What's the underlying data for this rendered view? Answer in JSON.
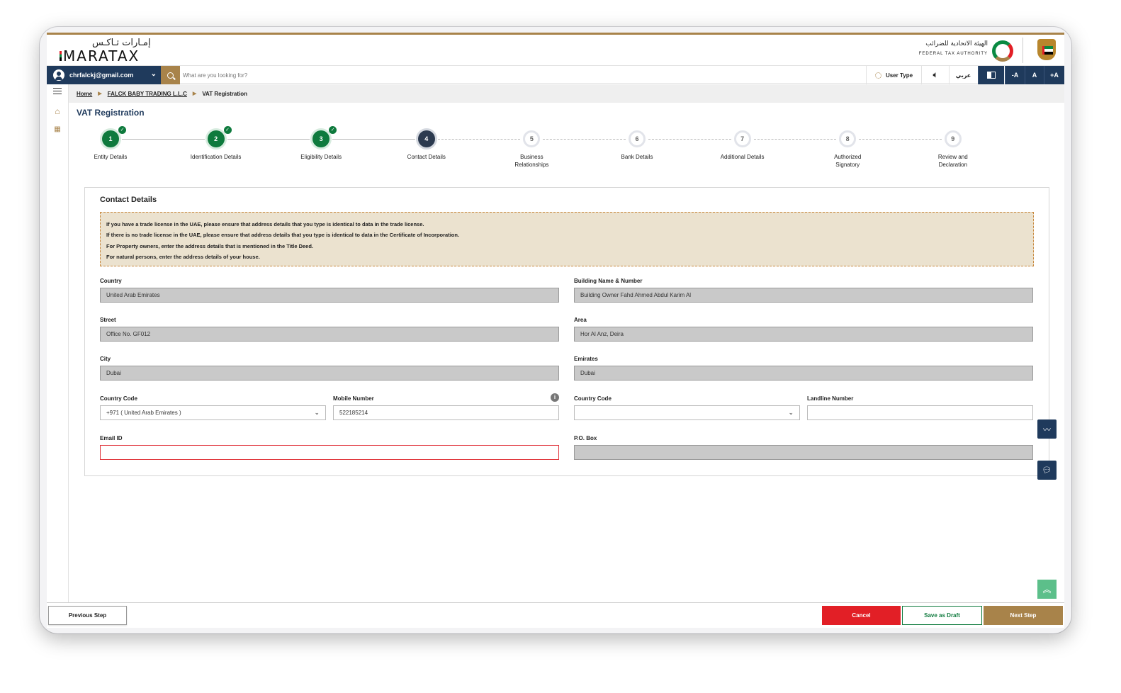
{
  "header": {
    "logo_arabic": "إمـارات تـاكـس",
    "logo_english": "MARATAX",
    "authority_arabic": "الهيئة الاتحادية للضرائب",
    "authority_english": "FEDERAL TAX AUTHORITY"
  },
  "toolbar": {
    "user_email": "chrfalckj@gmail.com",
    "search_placeholder": "What are you looking for?",
    "user_type_label": "User Type",
    "arabic_label": "عربي",
    "font_decrease": "-A",
    "font_reset": "A",
    "font_increase": "+A"
  },
  "breadcrumb": [
    "Home",
    "FALCK BABY TRADING L.L.C",
    "VAT Registration"
  ],
  "page": {
    "title": "VAT Registration"
  },
  "steps": [
    {
      "num": "1",
      "label": "Entity Details",
      "status": "done"
    },
    {
      "num": "2",
      "label": "Identification Details",
      "status": "done"
    },
    {
      "num": "3",
      "label": "Eligibility Details",
      "status": "done"
    },
    {
      "num": "4",
      "label": "Contact Details",
      "status": "active"
    },
    {
      "num": "5",
      "label": "Business Relationships",
      "status": "todo"
    },
    {
      "num": "6",
      "label": "Bank Details",
      "status": "todo"
    },
    {
      "num": "7",
      "label": "Additional Details",
      "status": "todo"
    },
    {
      "num": "8",
      "label": "Authorized Signatory",
      "status": "todo"
    },
    {
      "num": "9",
      "label": "Review and Declaration",
      "status": "todo"
    }
  ],
  "check_mark": "✓",
  "card": {
    "title": "Contact Details",
    "notice": [
      "If you have a trade license in the UAE, please ensure that address details that you type is identical to data in the trade license.",
      "If there is no trade license in the UAE, please ensure that address details that you type is identical to data in the Certificate of Incorporation.",
      "For Property owners, enter the address details that is mentioned in the Title Deed.",
      "For natural persons, enter the address details of your house."
    ]
  },
  "fields": {
    "country": {
      "label": "Country",
      "value": "United Arab Emirates"
    },
    "building": {
      "label": "Building Name & Number",
      "value": "Building Owner Fahd Ahmed Abdul Karim Al"
    },
    "street": {
      "label": "Street",
      "value": "Office No. GF012"
    },
    "area": {
      "label": "Area",
      "value": "Hor Al Anz, Deira"
    },
    "city": {
      "label": "City",
      "value": "Dubai"
    },
    "emirates": {
      "label": "Emirates",
      "value": "Dubai"
    },
    "mobile_country_code": {
      "label": "Country Code",
      "value": "+971 ( United Arab Emirates )"
    },
    "mobile_number": {
      "label": "Mobile Number",
      "value": "522185214"
    },
    "landline_country_code": {
      "label": "Country Code",
      "value": ""
    },
    "landline_number": {
      "label": "Landline Number",
      "value": ""
    },
    "email": {
      "label": "Email ID",
      "value": ""
    },
    "po_box": {
      "label": "P.O. Box",
      "value": ""
    }
  },
  "footer": {
    "previous": "Previous Step",
    "cancel": "Cancel",
    "save_draft": "Save as Draft",
    "next": "Next Step"
  },
  "colors": {
    "navy": "#1f3a5c",
    "gold": "#a8834a",
    "green": "#0e7a3d",
    "red": "#e21f26",
    "notice_bg": "#ebe2cf"
  }
}
